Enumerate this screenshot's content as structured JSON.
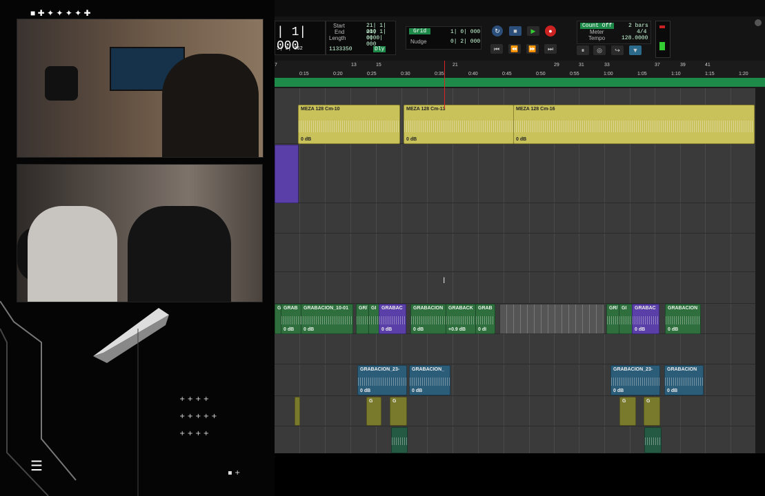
{
  "transport": {
    "main_counter": "| 1| 000",
    "start_label": "Start",
    "end_label": "End",
    "length_label": "Length",
    "start_value": "21| 1| 000",
    "end_value": "21| 1| 000",
    "length_value": "0| 0| 000",
    "sub_counter": "3| 3| 362",
    "samples": "1133350",
    "dly_label": "Dly",
    "grid_label": "Grid",
    "grid_value": "1| 0| 000",
    "nudge_label": "Nudge",
    "nudge_value": "0| 2| 000",
    "count_off": "Count Off",
    "meter_label": "Meter",
    "tempo_label": "Tempo",
    "count_value": "2 bars",
    "meter_value": "4/4",
    "tempo_value": "128.0000"
  },
  "ruler": {
    "bars": [
      "7",
      "13",
      "15",
      "21",
      "29",
      "31",
      "33",
      "37",
      "39",
      "41"
    ],
    "times": [
      "0:15",
      "0:20",
      "0:25",
      "0:30",
      "0:35",
      "0:40",
      "0:45",
      "0:50",
      "0:55",
      "1:00",
      "1:05",
      "1:10",
      "1:15",
      "1:20"
    ]
  },
  "clips": {
    "meza1": {
      "name": "MEZA 128 Cm-10",
      "gain": "0 dB"
    },
    "meza2": {
      "name": "MEZA 128 Cm-13",
      "gain": "0 dB"
    },
    "meza3": {
      "name": "MEZA 128 Cm-16",
      "gain": "0 dB"
    },
    "g1": {
      "name": "G",
      "gain": ""
    },
    "g2": {
      "name": "GRAB",
      "gain": "0 dB"
    },
    "g3": {
      "name": "GRABACION_10-01",
      "gain": "0 dB"
    },
    "g4": {
      "name": "GR/",
      "gain": ""
    },
    "g5": {
      "name": "GI",
      "gain": ""
    },
    "g6": {
      "name": "GRABAC",
      "gain": "0 dB"
    },
    "g7": {
      "name": "GRABACION",
      "gain": "0 dB"
    },
    "g8": {
      "name": "GRABACK",
      "gain": "+0.9 dB"
    },
    "g9": {
      "name": "GRAB",
      "gain": "0 dI"
    },
    "g10": {
      "name": "GR/",
      "gain": ""
    },
    "g11": {
      "name": "GI",
      "gain": ""
    },
    "g12": {
      "name": "GRABAC",
      "gain": "0 dB"
    },
    "g13": {
      "name": "GRABACION",
      "gain": "0 dB"
    },
    "b1": {
      "name": "GRABACION_23-",
      "gain": "0 dB"
    },
    "b2": {
      "name": "GRABACION_",
      "gain": "0 dB"
    },
    "b3": {
      "name": "GRABACION_23-",
      "gain": "0 dB"
    },
    "b4": {
      "name": "GRABACION",
      "gain": "0 dB"
    },
    "small": {
      "name": "G"
    }
  },
  "overlay": {
    "menu_glyph": "☰"
  },
  "colors": {
    "clip_yellow": "#c9c15a",
    "clip_green": "#2f6f3e",
    "clip_purple": "#5a3fa8",
    "clip_blue": "#2b5c78",
    "timeline_green": "#1e8a4a",
    "playhead": "#dd2222"
  }
}
